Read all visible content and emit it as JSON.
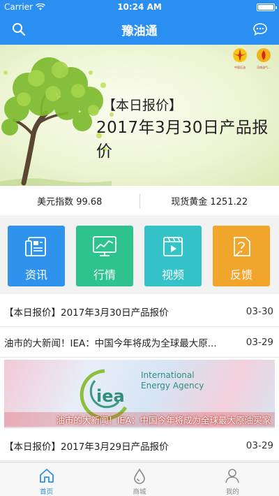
{
  "status_bar": {
    "carrier": "Carrier",
    "time": "10:24 AM",
    "battery_level": 1.0
  },
  "nav": {
    "title": "豫油通",
    "left_icon": "search-icon",
    "right_icon": "chat-icon"
  },
  "banner": {
    "line1": "【本日报价】",
    "line2": "2017年3月30日产品报价",
    "logo1_caption": "中国石油",
    "logo2_caption": "河南油气..."
  },
  "ticker": {
    "usd_index": "美元指数 99.68",
    "gold_spot": "现货黄金 1251.22"
  },
  "quick_menu": [
    {
      "label": "资讯",
      "icon": "news-icon",
      "color": "#2f93ee"
    },
    {
      "label": "行情",
      "icon": "chart-icon",
      "color": "#2ec28f"
    },
    {
      "label": "视频",
      "icon": "video-icon",
      "color": "#34c3c9"
    },
    {
      "label": "反馈",
      "icon": "feedback-icon",
      "color": "#f1a52a"
    }
  ],
  "news": [
    {
      "title": "【本日报价】2017年3月30日产品报价",
      "date": "03-30"
    },
    {
      "title": "油市的大新闻！IEA：中国今年将成为全球最大原...",
      "date": "03-29"
    }
  ],
  "feature": {
    "logo_text": "iea",
    "org_line1": "International",
    "org_line2": "Energy Agency",
    "caption": "油市的大新闻！IEA：中国今年将成为全球最大原油买家"
  },
  "news_after": {
    "title": "【本日报价】2017年3月29日产品报价",
    "date": "03-29"
  },
  "tabs": [
    {
      "label": "首页",
      "icon": "home-icon",
      "active": true
    },
    {
      "label": "商城",
      "icon": "drop-icon",
      "active": false
    },
    {
      "label": "我的",
      "icon": "user-icon",
      "active": false
    }
  ]
}
